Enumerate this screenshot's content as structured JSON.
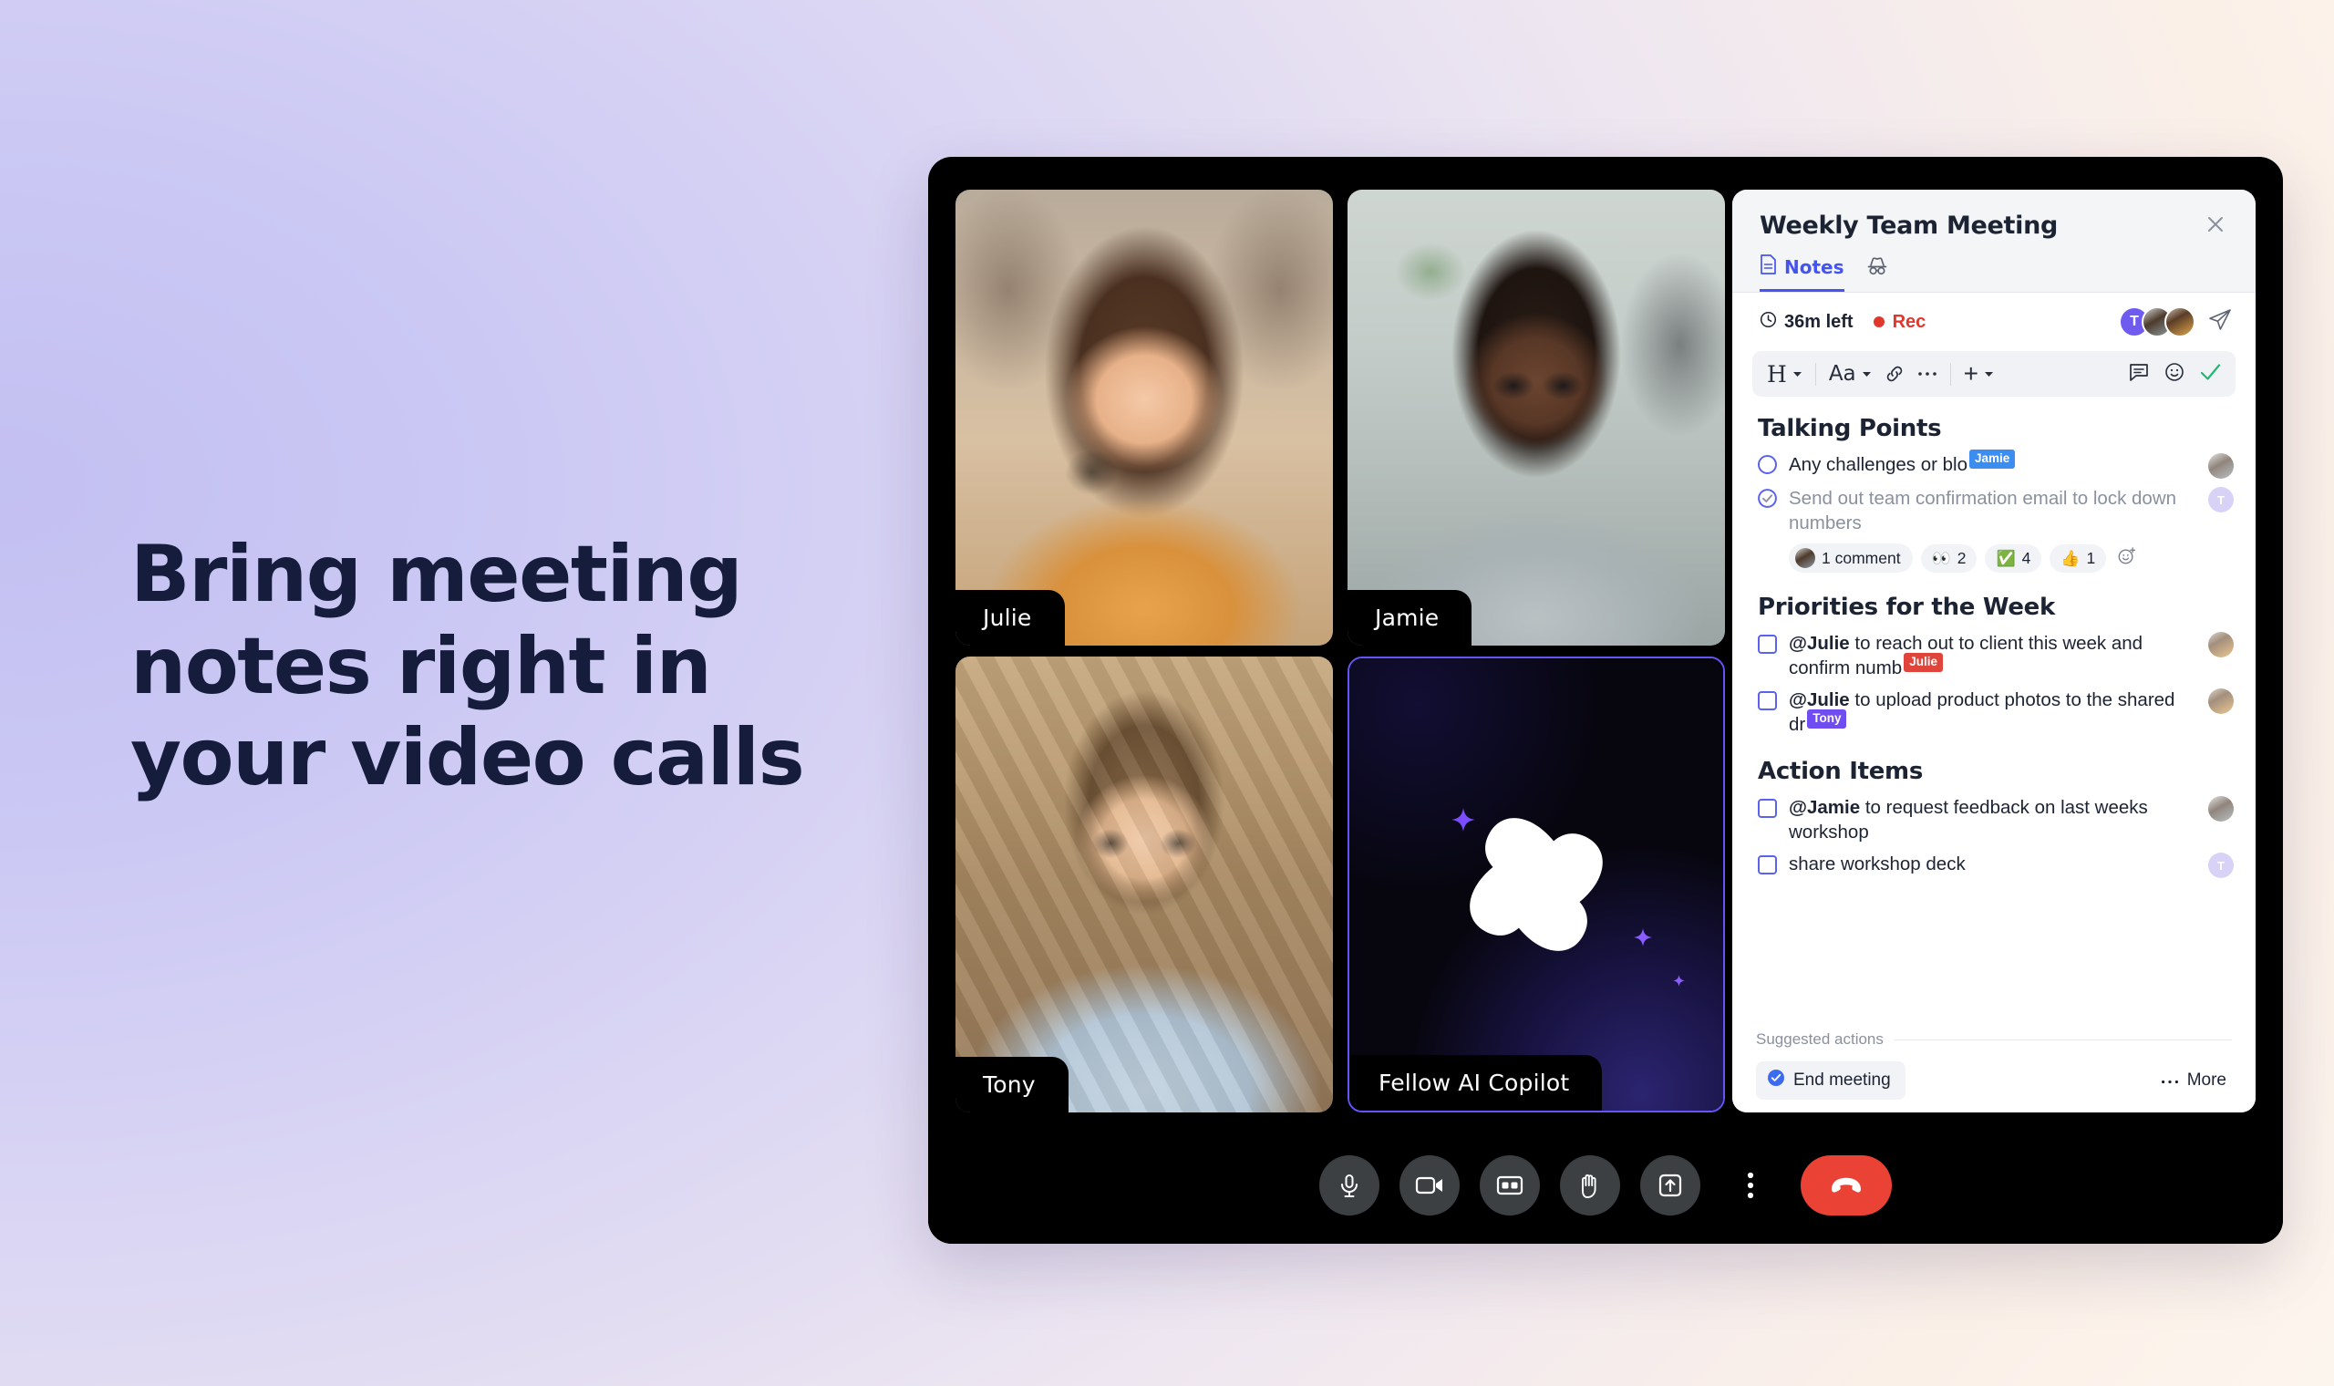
{
  "hero": {
    "line1": "Bring meeting",
    "line2": "notes right in",
    "line3": "your video calls"
  },
  "colors": {
    "accent_blue": "#4553f0",
    "accent_purple": "#6355f6",
    "rec_red": "#e0362c",
    "end_call_red": "#ea4335",
    "heading_navy": "#161c3b"
  },
  "call": {
    "tiles": [
      {
        "name": "Julie",
        "id": "julie"
      },
      {
        "name": "Jamie",
        "id": "jamie"
      },
      {
        "name": "Tony",
        "id": "tony"
      },
      {
        "name": "Fellow AI Copilot",
        "id": "ai-copilot"
      }
    ],
    "controls": [
      {
        "name": "microphone",
        "icon": "mic-icon"
      },
      {
        "name": "camera",
        "icon": "video-camera-icon"
      },
      {
        "name": "captions",
        "icon": "closed-captions-icon"
      },
      {
        "name": "raise-hand",
        "icon": "raised-hand-icon"
      },
      {
        "name": "present-screen",
        "icon": "present-screen-icon"
      },
      {
        "name": "more-options",
        "icon": "more-vertical-icon"
      },
      {
        "name": "end-call",
        "icon": "hang-up-icon"
      }
    ]
  },
  "notes_panel": {
    "title": "Weekly Team Meeting",
    "close_icon": "close-icon",
    "tabs": [
      {
        "label": "Notes",
        "icon": "document-icon",
        "active": true
      },
      {
        "label": "",
        "icon": "incognito-icon",
        "active": false
      }
    ],
    "meta": {
      "time_left": "36m left",
      "clock_icon": "clock-icon",
      "recording_label": "Rec",
      "send_icon": "send-icon",
      "avatars": [
        {
          "initial": "T",
          "type": "initial"
        },
        {
          "initial": "",
          "type": "photo-jamie"
        },
        {
          "initial": "",
          "type": "photo-julie"
        }
      ]
    },
    "toolbar": {
      "heading_label": "H",
      "font_label": "Aa",
      "link_icon": "link-icon",
      "more_icon": "ellipsis-icon",
      "plus_label": "+",
      "comment_icon": "comment-icon",
      "emoji_icon": "emoji-icon",
      "check_icon": "checkmark-icon"
    },
    "sections": [
      {
        "title": "Talking Points",
        "items": [
          {
            "checkbox": "circle-empty",
            "text": "Any challenges or blo",
            "cursor_tag": "Jamie",
            "tag_color": "#3b8ef0",
            "avatar": "jamie",
            "done": false
          },
          {
            "checkbox": "circle-checked",
            "text": "Send out team confirmation email to lock down numbers",
            "cursor_tag": "",
            "avatar": "t",
            "done": true,
            "reactions": [
              {
                "kind": "comment",
                "label": "1 comment",
                "count": ""
              },
              {
                "kind": "emoji",
                "emoji": "👀",
                "count": "2"
              },
              {
                "kind": "emoji",
                "emoji": "✅",
                "count": "4"
              },
              {
                "kind": "emoji",
                "emoji": "👍",
                "count": "1"
              }
            ]
          }
        ]
      },
      {
        "title": "Priorities for the Week",
        "items": [
          {
            "checkbox": "square-empty",
            "mention": "@Julie",
            "text": " to reach out to client this week and confirm numb",
            "cursor_tag": "Julie",
            "tag_color": "#e0453c",
            "avatar": "julie",
            "done": false
          },
          {
            "checkbox": "square-empty",
            "mention": "@Julie",
            "text": " to upload product photos to the shared dr",
            "cursor_tag": "Tony",
            "tag_color": "#6f4df0",
            "avatar": "julie",
            "done": false
          }
        ]
      },
      {
        "title": "Action Items",
        "items": [
          {
            "checkbox": "square-empty",
            "mention": "@Jamie",
            "text": " to request feedback on last weeks workshop",
            "cursor_tag": "",
            "avatar": "jamie",
            "done": false
          },
          {
            "checkbox": "square-empty",
            "mention": "",
            "text": "share workshop deck",
            "cursor_tag": "",
            "avatar": "t",
            "done": false
          }
        ]
      }
    ],
    "suggested_actions": {
      "label": "Suggested actions",
      "end_meeting_label": "End meeting",
      "end_meeting_icon": "check-circle-icon",
      "more_label": "More",
      "more_icon": "ellipsis-icon"
    }
  }
}
